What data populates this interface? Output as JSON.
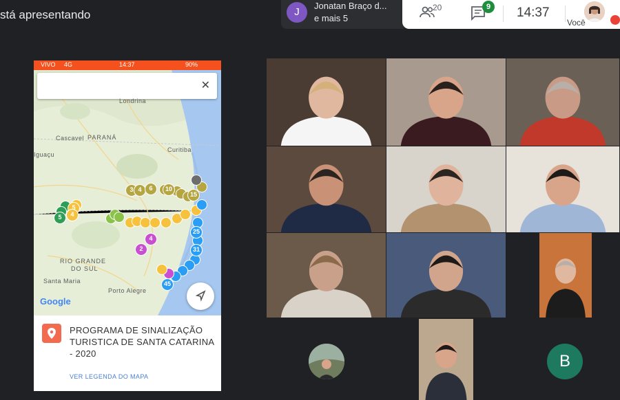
{
  "header": {
    "presenting_text": "stá apresentando",
    "participant_chip": {
      "avatar_letter": "J",
      "name": "Jonatan Braço d...",
      "more": "e mais 5",
      "avatar_color": "#7e57c2"
    },
    "toolbar": {
      "people_count": "20",
      "chat_badge": "9",
      "time": "14:37",
      "self_label": "Você"
    }
  },
  "phone": {
    "status": {
      "carrier": "VIVO",
      "network": "4G",
      "time": "14:37",
      "battery": "90%"
    },
    "map_labels": [
      "Londrina",
      "Cascavel",
      "PARANÁ",
      "Curitiba",
      "Iguaçu",
      "RIO GRANDE",
      "DO SUL",
      "Santa Maria",
      "Porto Alegre"
    ],
    "google_logo": "Google",
    "info_title": "PROGRAMA DE SINALIZAÇÃO TURISTICA DE SANTA CATARINA - 2020",
    "info_link": "VER LEGENDA DO MAPA",
    "markers": [
      {
        "label": "3",
        "color": "#b5a642"
      },
      {
        "label": "4",
        "color": "#b5a642"
      },
      {
        "label": "6",
        "color": "#b5a642"
      },
      {
        "label": "10",
        "color": "#b5a642"
      },
      {
        "label": "15",
        "color": "#b5a642"
      },
      {
        "label": "5",
        "color": "#f6c23e"
      },
      {
        "label": "4",
        "color": "#f6c23e"
      },
      {
        "label": "5",
        "color": "#2e9e55"
      },
      {
        "label": "25",
        "color": "#2a9df4"
      },
      {
        "label": "31",
        "color": "#2a9df4"
      },
      {
        "label": "45",
        "color": "#2a9df4"
      },
      {
        "label": "4",
        "color": "#c94fd0"
      },
      {
        "label": "2",
        "color": "#c94fd0"
      }
    ]
  },
  "grid": {
    "tiles": [
      {
        "name": "participant-1"
      },
      {
        "name": "participant-2"
      },
      {
        "name": "participant-3"
      },
      {
        "name": "participant-4"
      },
      {
        "name": "participant-5"
      },
      {
        "name": "participant-6"
      },
      {
        "name": "participant-7"
      },
      {
        "name": "participant-8"
      },
      {
        "name": "participant-9"
      },
      {
        "name": "participant-10"
      },
      {
        "name": "participant-11"
      },
      {
        "name": "participant-12"
      }
    ],
    "letter_avatar": {
      "letter": "B",
      "color": "#1e7a5f"
    }
  }
}
